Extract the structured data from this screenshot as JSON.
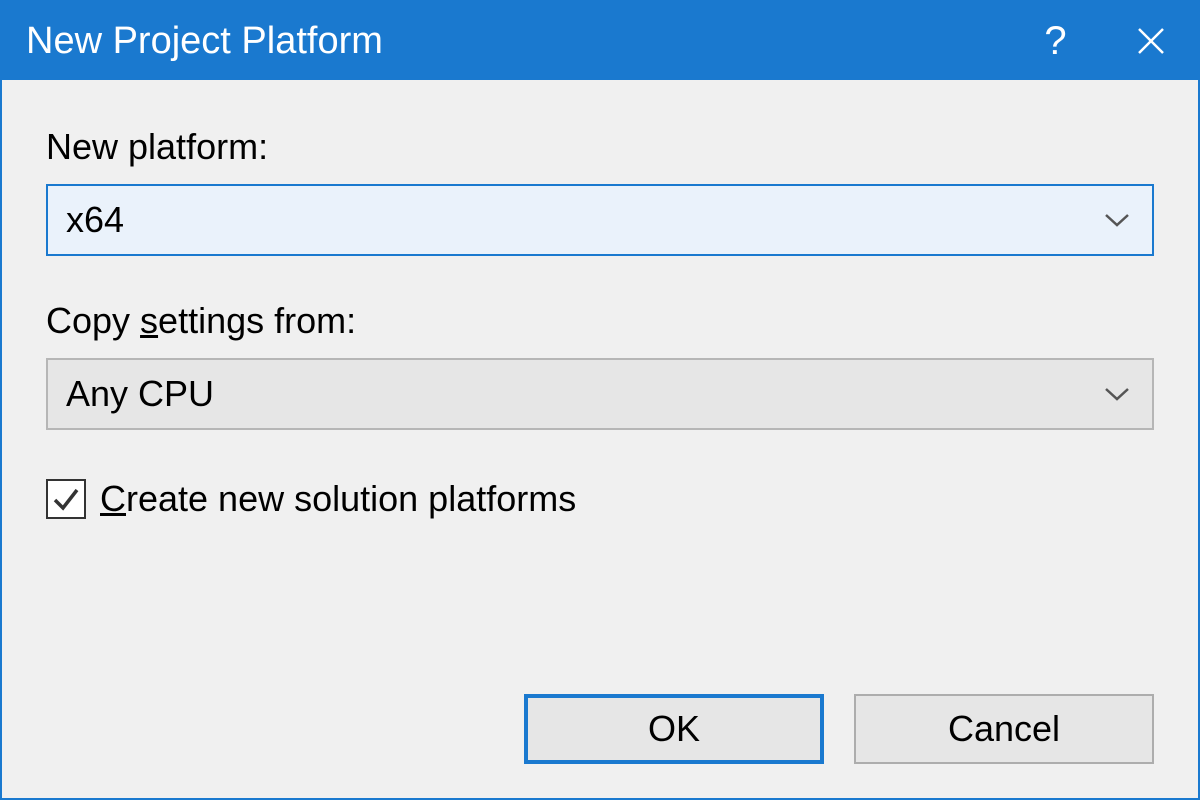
{
  "dialog": {
    "title": "New Project Platform",
    "new_platform_label": "New platform:",
    "new_platform_value": "x64",
    "copy_settings_label_pre": "Copy ",
    "copy_settings_label_u": "s",
    "copy_settings_label_post": "ettings from:",
    "copy_settings_value": "Any CPU",
    "checkbox_checked": true,
    "checkbox_label_u": "C",
    "checkbox_label_post": "reate new solution platforms",
    "ok_label": "OK",
    "cancel_label": "Cancel"
  }
}
